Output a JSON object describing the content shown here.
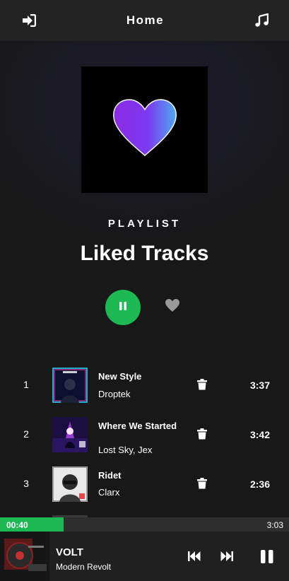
{
  "header": {
    "title": "Home",
    "left_icon": "logout-icon",
    "right_icon": "music-note-icon"
  },
  "playlist": {
    "kicker": "PLAYLIST",
    "title": "Liked Tracks",
    "cover_icon": "heart-icon",
    "play_state": "playing"
  },
  "tracks": [
    {
      "number": "1",
      "name": "New Style",
      "artist": "Droptek",
      "duration": "3:37"
    },
    {
      "number": "2",
      "name": "Where We Started",
      "artist": "Lost Sky, Jex",
      "duration": "3:42"
    },
    {
      "number": "3",
      "name": "Ridet",
      "artist": "Clarx",
      "duration": "2:36"
    }
  ],
  "progress": {
    "current": "00:40",
    "total": "3:03",
    "fraction": 0.22
  },
  "now_playing": {
    "title": "VOLT",
    "artist": "Modern Revolt"
  },
  "colors": {
    "accent": "#1db954",
    "background": "#181818",
    "header": "#232323"
  }
}
